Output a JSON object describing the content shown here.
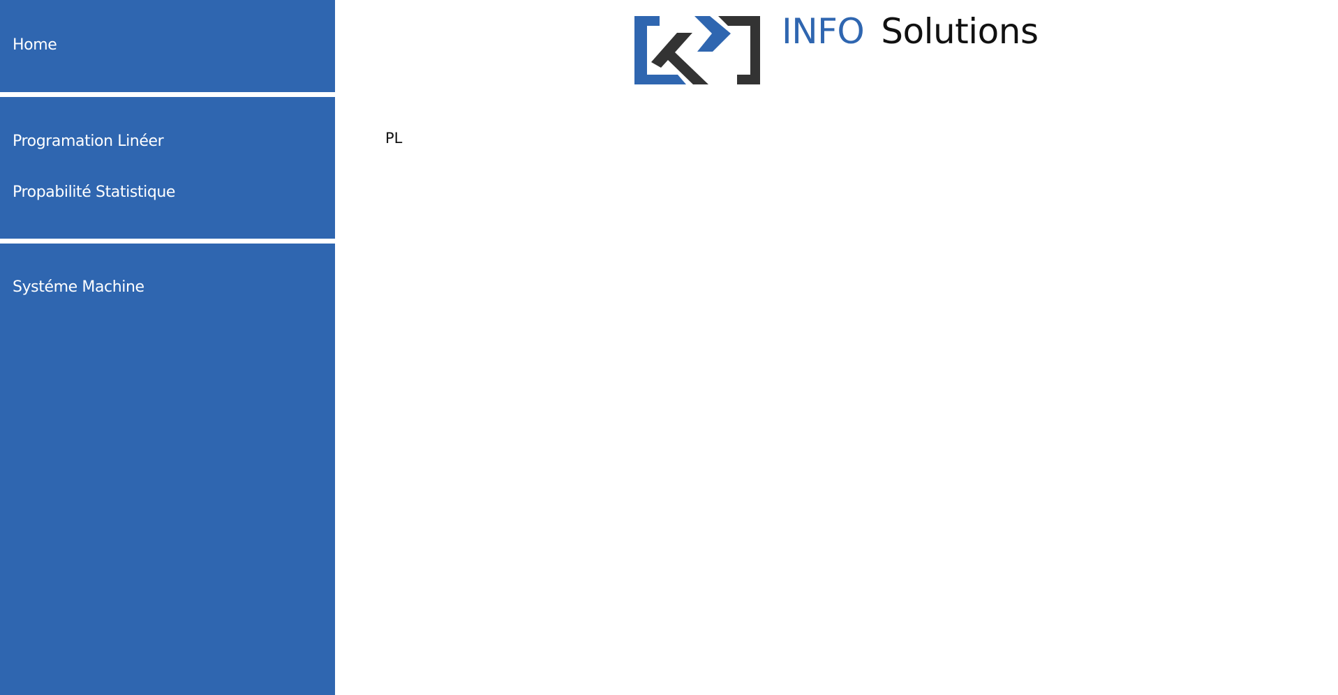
{
  "sidebar": {
    "items": [
      {
        "label": "Home"
      },
      {
        "label": "Programation Linéer"
      },
      {
        "label": "Propabilité Statistique"
      },
      {
        "label": "Systéme Machine"
      }
    ]
  },
  "header": {
    "brand_primary": "INFO",
    "brand_secondary": "Solutions",
    "logo_icon": "brand-logo-icon"
  },
  "main": {
    "content_text": "PL"
  },
  "colors": {
    "accent": "#2f66b0",
    "sidebar_text": "#ffffff",
    "logo_dark": "#333333"
  }
}
